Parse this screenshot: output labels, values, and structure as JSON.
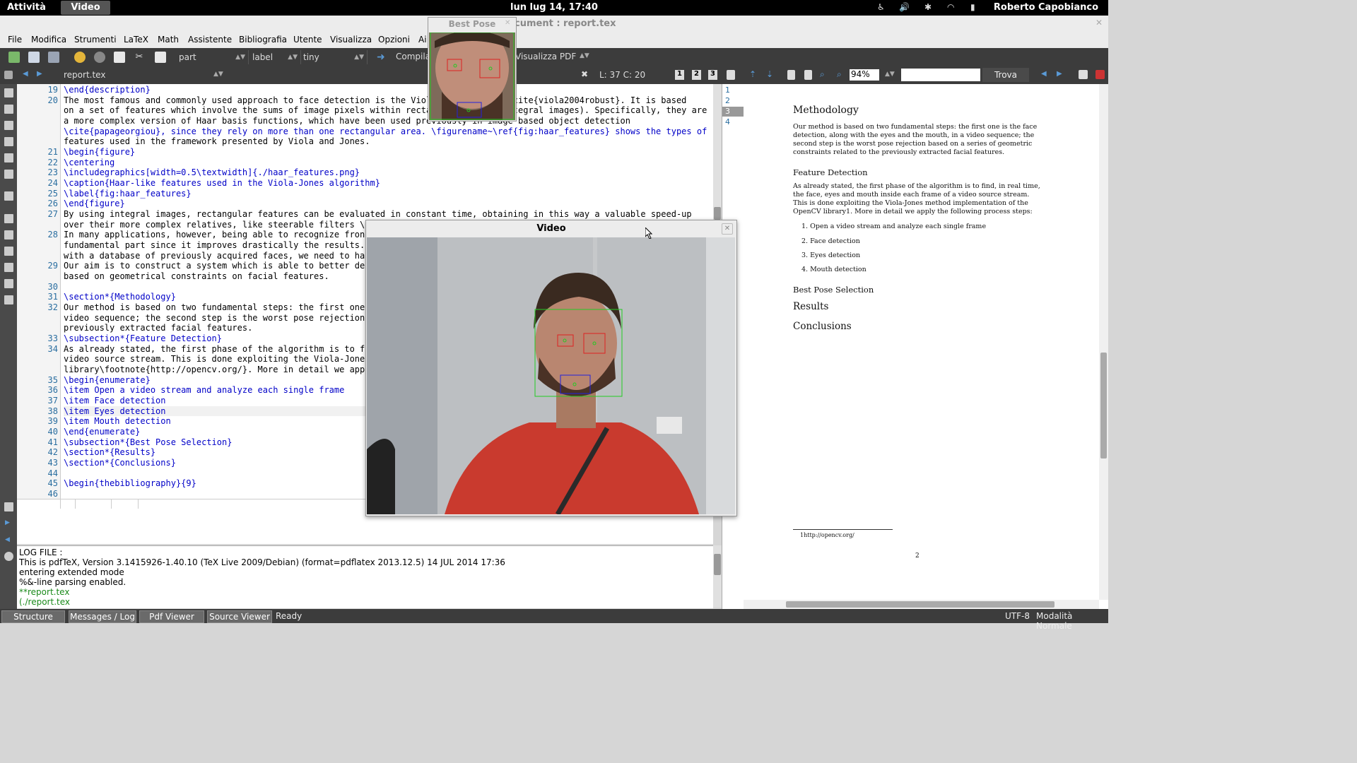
{
  "topbar": {
    "activities": "Attività",
    "app": "Video",
    "clock": "lun lug 14, 17:40",
    "user": "Roberto Capobianco"
  },
  "window": {
    "title": "cument : report.tex"
  },
  "menu": [
    "File",
    "Modifica",
    "Strumenti",
    "LaTeX",
    "Math",
    "Assistente",
    "Bibliografia",
    "Utente",
    "Visualizza",
    "Opzioni",
    "Ai"
  ],
  "toolbar": {
    "combo1": "part",
    "combo2": "label",
    "combo3": "tiny",
    "compile": "Compila",
    "view": "Visualizza  PDF"
  },
  "tabbar": {
    "file": "report.tex",
    "cursor": "L: 37 C: 20",
    "zoom": "94%",
    "find": "Trova"
  },
  "editor": {
    "lines": [
      {
        "n": "19",
        "t": "\\end{description}"
      },
      {
        "n": "20",
        "t": "The most famous and commonly used approach to face detection is the Viola-Jones method \\cite{viola2004robust}. It is based"
      },
      {
        "n": "",
        "t": "on a set of features which involve the sums of image pixels within rectangular areas (integral images). Specifically, they are"
      },
      {
        "n": "",
        "t": "a more complex version of Haar basis functions, which have been used previously in image-based object detection"
      },
      {
        "n": "",
        "t": "\\cite{papageorgiou}, since they rely on more than one rectangular area. \\figurename~\\ref{fig:haar_features} shows the types of"
      },
      {
        "n": "",
        "t": "features used in the framework presented by Viola and Jones."
      },
      {
        "n": "21",
        "t": "\\begin{figure}"
      },
      {
        "n": "22",
        "t": "\\centering"
      },
      {
        "n": "23",
        "t": "\\includegraphics[width=0.5\\textwidth]{./haar_features.png}"
      },
      {
        "n": "24",
        "t": "\\caption{Haar-like features used in the Viola-Jones algorithm}"
      },
      {
        "n": "25",
        "t": "\\label{fig:haar_features}"
      },
      {
        "n": "26",
        "t": "\\end{figure}"
      },
      {
        "n": "27",
        "t": "By using integral images, rectangular features can be evaluated in constant time, obtaining in this way a valuable speed-up"
      },
      {
        "n": "",
        "t": "over their more complex relatives, like steerable filters \\"
      },
      {
        "n": "28",
        "t": "In many applications, however, being able to recognize fron"
      },
      {
        "n": "",
        "t": "fundamental part since it improves drastically the results."
      },
      {
        "n": "",
        "t": "with a database of previously acquired faces, we need to ha"
      },
      {
        "n": "29",
        "t": "Our aim is to construct a system which is able to better de"
      },
      {
        "n": "",
        "t": "based on geometrical constraints on facial features."
      },
      {
        "n": "30",
        "t": ""
      },
      {
        "n": "31",
        "t": "\\section*{Methodology}"
      },
      {
        "n": "32",
        "t": "Our method is based on two fundamental steps: the first one"
      },
      {
        "n": "",
        "t": "video sequence; the second step is the worst pose rejection"
      },
      {
        "n": "",
        "t": "previously extracted facial features."
      },
      {
        "n": "33",
        "t": "\\subsection*{Feature Detection}"
      },
      {
        "n": "34",
        "t": "As already stated, the first phase of the algorithm is to f"
      },
      {
        "n": "",
        "t": "video source stream. This is done exploiting the Viola-Jones"
      },
      {
        "n": "",
        "t": "library\\footnote{http://opencv.org/}. More in detail we app"
      },
      {
        "n": "35",
        "t": "\\begin{enumerate}"
      },
      {
        "n": "36",
        "t": "\\item Open a video stream and analyze each single frame"
      },
      {
        "n": "37",
        "t": "\\item Face detection"
      },
      {
        "n": "38",
        "t": "\\item Eyes detection"
      },
      {
        "n": "39",
        "t": "\\item Mouth detection"
      },
      {
        "n": "40",
        "t": "\\end{enumerate}"
      },
      {
        "n": "41",
        "t": "\\subsection*{Best Pose Selection}"
      },
      {
        "n": "42",
        "t": "\\section*{Results}"
      },
      {
        "n": "43",
        "t": "\\section*{Conclusions}"
      },
      {
        "n": "44",
        "t": ""
      },
      {
        "n": "45",
        "t": "\\begin{thebibliography}{9}"
      },
      {
        "n": "46",
        "t": ""
      }
    ]
  },
  "structure_numbers": [
    "1",
    "2",
    "3",
    "4"
  ],
  "log": {
    "lines": [
      "LOG FILE :",
      "This is pdfTeX, Version 3.1415926-1.40.10 (TeX Live 2009/Debian) (format=pdflatex 2013.12.5) 14 JUL 2014 17:36",
      "entering extended mode",
      "%&-line parsing enabled.",
      "**report.tex",
      "(./report.tex"
    ]
  },
  "statusbar": {
    "tabs": [
      "Structure",
      "Messages / Log",
      "Pdf Viewer",
      "Source Viewer"
    ],
    "state": "Ready",
    "encoding": "UTF-8",
    "mode": "Modalità Normale"
  },
  "pdf": {
    "h_methodology": "Methodology",
    "p_methodology": "Our method is based on two fundamental steps: the first one is the face detection, along with the eyes and the mouth, in a video sequence; the second step is the worst pose rejection based on a series of geometric constraints related to the previously extracted facial features.",
    "h_feature": "Feature Detection",
    "p_feature": "As already stated, the first phase of the algorithm is to find, in real time, the face, eyes and mouth inside each frame of a video source stream. This is done exploiting the Viola-Jones method implementation of the OpenCV library1. More in detail we apply the following process steps:",
    "items": [
      "1.  Open a video stream and analyze each single frame",
      "2.  Face detection",
      "3.  Eyes detection",
      "4.  Mouth detection"
    ],
    "h_bestpose": "Best Pose Selection",
    "h_results": "Results",
    "h_conclusions": "Conclusions",
    "footnote": "1http://opencv.org/",
    "page": "2"
  },
  "bestpose": {
    "title": "Best Pose"
  },
  "video": {
    "title": "Video"
  }
}
